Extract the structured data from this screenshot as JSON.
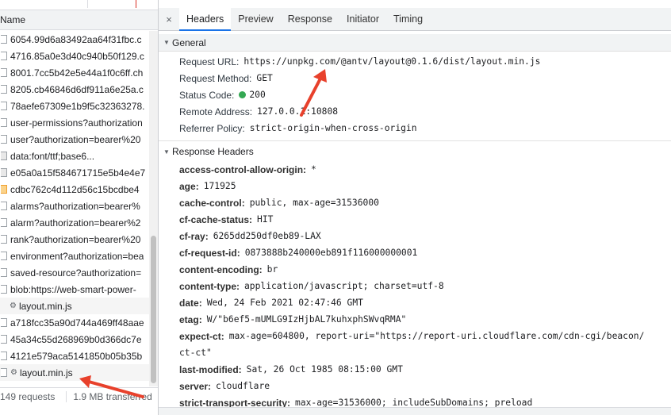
{
  "left": {
    "column_header": "Name",
    "rows": [
      {
        "label": "6054.99d6a83492aa64f31fbc.c",
        "kind": "file"
      },
      {
        "label": "4716.85a0e3d40c940b50f129.c",
        "kind": "file"
      },
      {
        "label": "8001.7cc5b42e5e44a1f0c6ff.ch",
        "kind": "file"
      },
      {
        "label": "8205.cb46846d6df911a6e25a.c",
        "kind": "file"
      },
      {
        "label": "78aefe67309e1b9f5c32363278.",
        "kind": "file"
      },
      {
        "label": "user-permissions?authorization",
        "kind": "file"
      },
      {
        "label": "user?authorization=bearer%20",
        "kind": "file"
      },
      {
        "label": "data:font/ttf;base6...",
        "kind": "font"
      },
      {
        "label": "e05a0a15f584671715e5b4e4e7",
        "kind": "font"
      },
      {
        "label": "cdbc762c4d112d56c15bcdbe4",
        "kind": "img"
      },
      {
        "label": "alarms?authorization=bearer%",
        "kind": "file"
      },
      {
        "label": "alarm?authorization=bearer%2",
        "kind": "file"
      },
      {
        "label": "rank?authorization=bearer%20",
        "kind": "file"
      },
      {
        "label": "environment?authorization=bea",
        "kind": "file"
      },
      {
        "label": "saved-resource?authorization=",
        "kind": "file"
      },
      {
        "label": "blob:https://web-smart-power-",
        "kind": "file"
      },
      {
        "label": "layout.min.js",
        "kind": "gear"
      },
      {
        "label": "a718fcc35a90d744a469ff48aae",
        "kind": "file"
      },
      {
        "label": "45a34c55d268969b0d366dc7e",
        "kind": "file"
      },
      {
        "label": "4121e579aca5141850b05b35b",
        "kind": "file"
      },
      {
        "label": "layout.min.js",
        "kind": "gear-file"
      }
    ],
    "status_requests": "149 requests",
    "status_transferred": "1.9 MB transferred"
  },
  "right": {
    "close_icon": "×",
    "tabs": [
      "Headers",
      "Preview",
      "Response",
      "Initiator",
      "Timing"
    ],
    "active_tab": "Headers",
    "general": {
      "title": "General",
      "request_url_label": "Request URL:",
      "request_url": "https://unpkg.com/@antv/layout@0.1.6/dist/layout.min.js",
      "request_method_label": "Request Method:",
      "request_method": "GET",
      "status_code_label": "Status Code:",
      "status_code": "200",
      "remote_address_label": "Remote Address:",
      "remote_address": "127.0.0.1:10808",
      "referrer_policy_label": "Referrer Policy:",
      "referrer_policy": "strict-origin-when-cross-origin"
    },
    "response_headers": {
      "title": "Response Headers",
      "items": [
        {
          "name": "access-control-allow-origin",
          "value": "*"
        },
        {
          "name": "age",
          "value": "171925"
        },
        {
          "name": "cache-control",
          "value": "public, max-age=31536000"
        },
        {
          "name": "cf-cache-status",
          "value": "HIT"
        },
        {
          "name": "cf-ray",
          "value": "6265dd250df0eb89-LAX"
        },
        {
          "name": "cf-request-id",
          "value": "0873888b240000eb891f116000000001"
        },
        {
          "name": "content-encoding",
          "value": "br"
        },
        {
          "name": "content-type",
          "value": "application/javascript; charset=utf-8"
        },
        {
          "name": "date",
          "value": "Wed, 24 Feb 2021 02:47:46 GMT"
        },
        {
          "name": "etag",
          "value": "W/\"b6ef5-mUMLG9IzHjbAL7kuhxphSWvqRMA\""
        },
        {
          "name": "expect-ct",
          "value": "max-age=604800, report-uri=\"https://report-uri.cloudflare.com/cdn-cgi/beacon/"
        },
        {
          "name": "",
          "value": "ct-ct\""
        },
        {
          "name": "last-modified",
          "value": "Sat, 26 Oct 1985 08:15:00 GMT"
        },
        {
          "name": "server",
          "value": "cloudflare"
        },
        {
          "name": "strict-transport-security",
          "value": "max-age=31536000; includeSubDomains; preload"
        }
      ]
    }
  },
  "colors": {
    "accent": "#1a73e8",
    "status_ok": "#34a853",
    "annotation_arrow": "#e8412c"
  }
}
